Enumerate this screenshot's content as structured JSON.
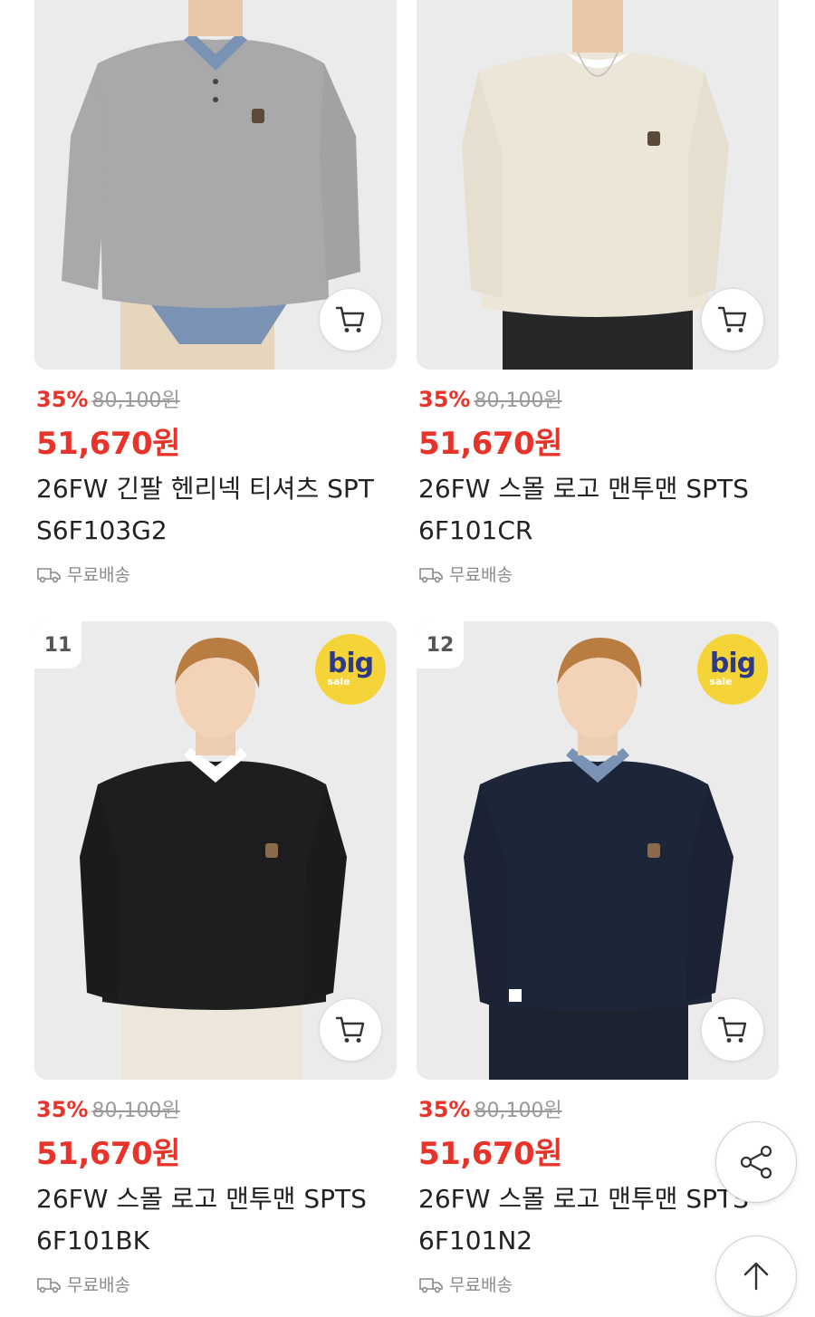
{
  "products": [
    {
      "rank": "",
      "discount": "35%",
      "original_price": "80,100원",
      "sale_price": "51,670원",
      "name": "26FW 긴팔 헨리넥 티셔츠 SPTS6F103G2",
      "shipping": "무료배송",
      "badge": "",
      "sweater_color": "#a9a9ab"
    },
    {
      "rank": "",
      "discount": "35%",
      "original_price": "80,100원",
      "sale_price": "51,670원",
      "name": "26FW 스몰 로고 맨투맨 SPTS6F101CR",
      "shipping": "무료배송",
      "badge": "",
      "sweater_color": "#ece6d8"
    },
    {
      "rank": "11",
      "discount": "35%",
      "original_price": "80,100원",
      "sale_price": "51,670원",
      "name": "26FW 스몰 로고 맨투맨 SPTS6F101BK",
      "shipping": "무료배송",
      "badge": {
        "big": "big",
        "sale": "sale"
      },
      "sweater_color": "#1e1e20"
    },
    {
      "rank": "12",
      "discount": "35%",
      "original_price": "80,100원",
      "sale_price": "51,670원",
      "name": "26FW 스몰 로고 맨투맨 SPTS6F101N2",
      "shipping": "무료배송",
      "badge": {
        "big": "big",
        "sale": "sale"
      },
      "sweater_color": "#1d2638"
    }
  ],
  "icons": {
    "cart": "cart-icon",
    "truck": "truck-icon",
    "share": "share-icon",
    "top": "arrow-up-icon"
  },
  "colors": {
    "accent_red": "#e8332a",
    "strike_gray": "#9a9a9a",
    "badge_yellow": "#f5d43a"
  }
}
